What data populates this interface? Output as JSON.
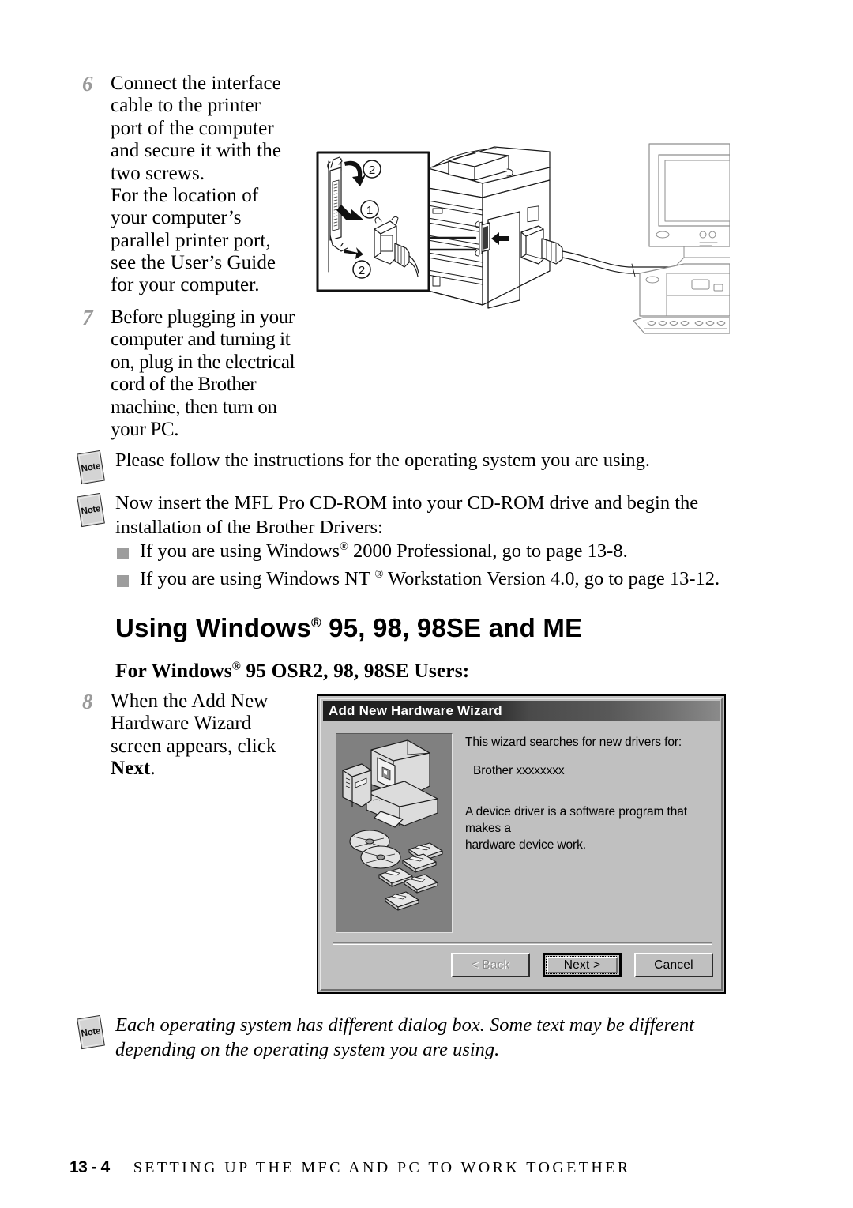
{
  "steps": [
    {
      "number": "6",
      "lines": [
        "Connect the interface",
        "cable to the printer",
        "port of the computer",
        "and secure it with the",
        "two screws.",
        "For the location of",
        "your computer’s",
        "parallel printer port,",
        "see the User’s Guide",
        "for your computer."
      ]
    },
    {
      "number": "7",
      "lines": [
        "Before plugging in your",
        "computer and turning it",
        "on, plug in the electrical",
        "cord of the Brother",
        "machine, then turn on",
        "your PC."
      ]
    },
    {
      "number": "8",
      "lines": [
        "When the Add New",
        "Hardware Wizard",
        "screen appears, click"
      ],
      "bold_tail": "Next",
      "tail_period": "."
    }
  ],
  "notes": [
    {
      "icon_label": "Note",
      "text": "Please follow the instructions for the operating system you are using."
    },
    {
      "icon_label": "Note",
      "line1": "Now insert the MFL Pro CD-ROM into your CD-ROM drive and begin the",
      "line2": "installation of the Brother Drivers:"
    },
    {
      "icon_label": "Note",
      "line1": "Each operating system has different dialog box. Some text may be different",
      "line2": "depending on the operating system you are using."
    }
  ],
  "bullets": [
    {
      "pre": "If you are using Windows",
      "reg": "®",
      "post": " 2000 Professional, go to page 13-8."
    },
    {
      "pre": "If you are using Windows NT ",
      "reg": "®",
      "post": " Workstation Version 4.0, go to page 13-12."
    }
  ],
  "headings": {
    "h1_pre": "Using Windows",
    "h1_reg": "®",
    "h1_post": " 95, 98, 98SE and ME",
    "h2_pre": "For Windows",
    "h2_reg": "®",
    "h2_post": " 95 OSR2, 98, 98SE Users:"
  },
  "figure_top": {
    "callout_marker_1": "①",
    "callout_marker_2a": "②",
    "callout_marker_2b": "②"
  },
  "wizard": {
    "title": "Add New Hardware Wizard",
    "text_1": "This wizard searches for new drivers for:",
    "device_name": "Brother xxxxxxxx",
    "text_2_line1": "A device driver is a software program that makes a",
    "text_2_line2": "hardware device work.",
    "buttons": {
      "back": "< Back",
      "back_prefix": "< ",
      "back_underline": "B",
      "back_rest": "ack",
      "next": "Next >",
      "cancel": "Cancel"
    }
  },
  "footer": {
    "page_number": "13 - 4",
    "title": "SETTING UP THE MFC AND PC TO WORK TOGETHER"
  },
  "colors": {
    "step_number": "#9a9a9a",
    "bullet_square": "#9d9d9d",
    "dialog_face": "#c0c0c0",
    "dialog_picture_bg": "#808080",
    "note_icon_fill": "#d4d4d4"
  }
}
